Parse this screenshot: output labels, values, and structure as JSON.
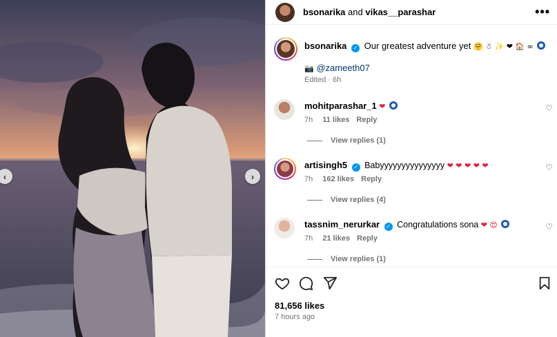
{
  "header": {
    "user1": "bsonarika",
    "joiner": "and",
    "user2": "vikas__parashar",
    "more": "•••"
  },
  "caption": {
    "username": "bsonarika",
    "text": "Our greatest adventure yet",
    "emojis": "🤗 ☃ ✨ ❤ 🏠 ∞",
    "camera": "📷",
    "mention": "@zameeth07",
    "meta": "Edited · 6h"
  },
  "comments": [
    {
      "username": "mohitparashar_1",
      "text": "",
      "emojis": "❤",
      "evil_eye": true,
      "verified": false,
      "time": "7h",
      "likes": "11 likes",
      "reply": "Reply",
      "view_replies": "View replies (1)"
    },
    {
      "username": "artisingh5",
      "text": "Babyyyyyyyyyyyyyyy",
      "emojis": "❤ ❤ ❤ ❤ ❤",
      "evil_eye": false,
      "verified": true,
      "time": "7h",
      "likes": "162 likes",
      "reply": "Reply",
      "view_replies": "View replies (4)"
    },
    {
      "username": "tassnim_nerurkar",
      "text": "Congratulations sona",
      "emojis": "❤ 😍",
      "evil_eye": true,
      "verified": true,
      "time": "7h",
      "likes": "21 likes",
      "reply": "Reply",
      "view_replies": "View replies (1)"
    }
  ],
  "footer": {
    "likes": "81,656 likes",
    "ago": "7 hours ago"
  },
  "nav": {
    "prev": "‹",
    "next": "›"
  },
  "icons": [
    "heart-icon",
    "comment-icon",
    "share-icon",
    "bookmark-icon",
    "verified-icon",
    "more-icon"
  ],
  "colors": {
    "verified": "#0095f6",
    "heart": "#e0203c",
    "muted": "#737373",
    "mention": "#00376b"
  }
}
